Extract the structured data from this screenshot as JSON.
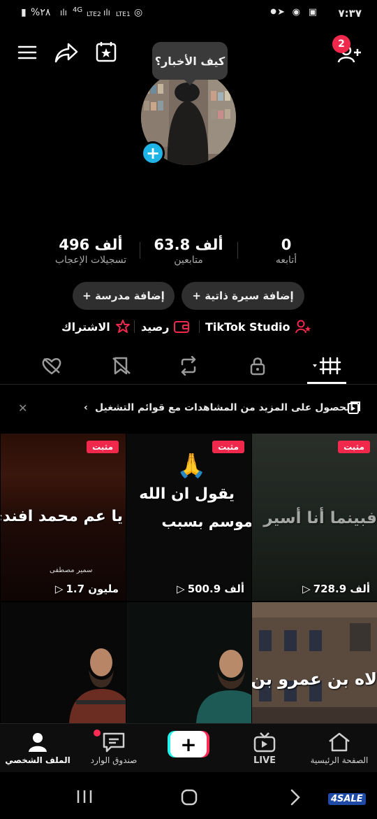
{
  "status_bar": {
    "time": "٧:٣٧",
    "battery": "%٢٨",
    "network_1": "4G",
    "network_2": "LTE2",
    "network_3": "LTE1"
  },
  "header": {
    "notification_count": "2",
    "bubble_text": "كيف الأخبار؟"
  },
  "stats": {
    "following_count": "0",
    "following_label": "أتابعه",
    "followers_count": "63.8 ألف",
    "followers_label": "متابعين",
    "likes_count": "496 ألف",
    "likes_label": "تسجيلات الإعجاب"
  },
  "actions": {
    "add_bio": "+ إضافة سيرة ذاتية",
    "add_school": "+ إضافة مدرسة"
  },
  "links": {
    "studio": "TikTok Studio",
    "balance": "رصيد",
    "subscription": "الاشتراك"
  },
  "banner": {
    "text": "الحصول على المزيد من المشاهدات مع قوائم التشغيل"
  },
  "videos": [
    {
      "pinned": "مثبت",
      "views": "728.9 ألف",
      "overlay": "فبينما أنا أسير"
    },
    {
      "pinned": "مثبت",
      "views": "500.9 ألف",
      "overlay_1": "يقول ان الله",
      "overlay_2": "موسم   بسبب"
    },
    {
      "pinned": "مثبت",
      "views": "1.7 مليون",
      "overlay": "يا عم محمد افندي",
      "caption": "سمير مصطفى"
    },
    {
      "overlay": "لاه بن عمرو بن ال"
    },
    {},
    {}
  ],
  "bottom_nav": {
    "home": "الصفحة الرئيسية",
    "live": "LIVE",
    "create": "+",
    "inbox": "صندوق الوارد",
    "profile": "الملف الشخصي"
  },
  "watermark": "4SALE",
  "colors": {
    "accent_red": "#f0294c",
    "accent_cyan": "#1fb4e6",
    "background": "#000000"
  }
}
